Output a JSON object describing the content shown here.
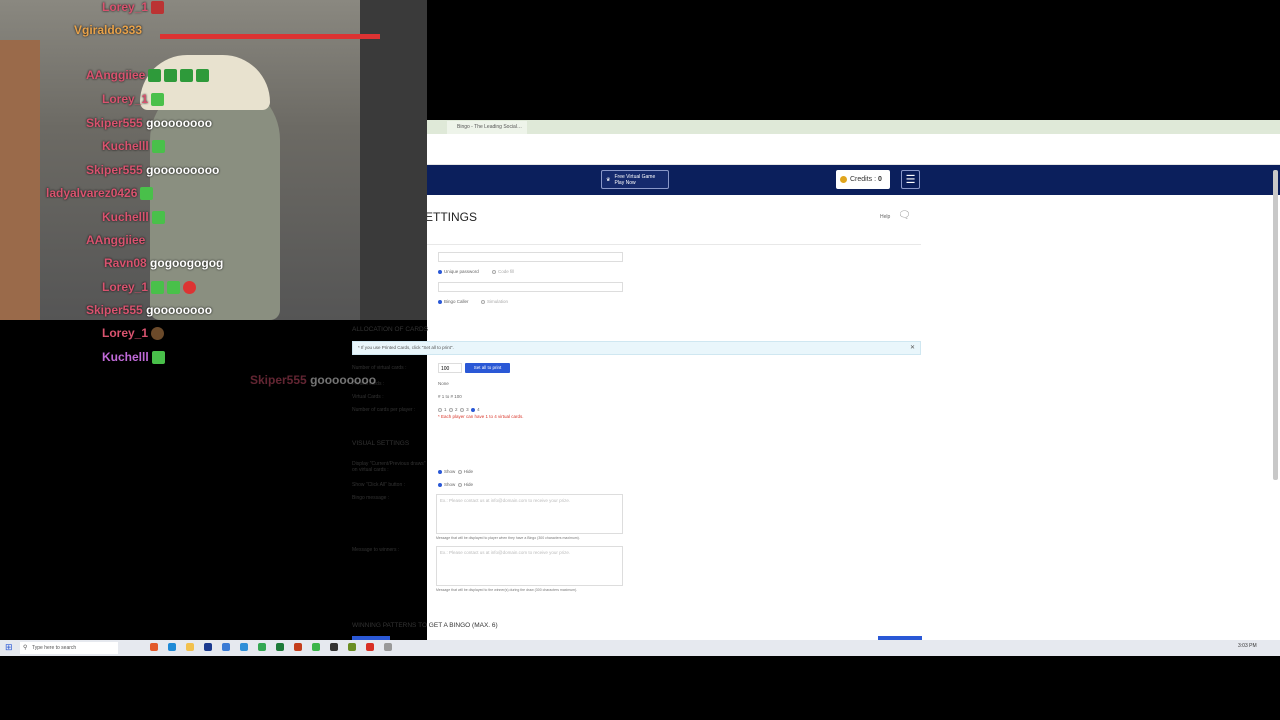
{
  "browser": {
    "tab_title": "Bingo - The Leading Social…",
    "nav": {
      "promo_label": "Free Virtual Game",
      "promo_sub": "Play Now",
      "credits_label": "Credits :",
      "credits_value": "0"
    },
    "page": {
      "title": "ETTINGS",
      "help_label": "Help",
      "unique_password_label": "Unique password",
      "code_label": "Code fill",
      "bingo_caller_label": "Bingo Caller",
      "simulation_label": "Simulation",
      "allocation": {
        "heading": "ALLOCATION OF CARDS",
        "notice": "* If you use Printed Cards, click \"Set all to print\".",
        "virtual_cards_number_label": "Number of virtual cards :",
        "virtual_cards_number_value": "100",
        "set_print_button": "Set all to print",
        "printed_cards_label": "Printed cards :",
        "printed_cards_value": "None",
        "virtual_cards_label": "Virtual Cards :",
        "virtual_cards_value": "# 1 to # 100",
        "cards_per_player_label": "Number of cards per player :",
        "cards_per_player_options": [
          "1",
          "2",
          "3",
          "4"
        ],
        "cards_per_player_note": "* Each player can have 1 to 4 virtual cards."
      },
      "visual": {
        "heading": "VISUAL SETTINGS",
        "display_draws_label": "Display \"Current/Previous draws\" on virtual cards :",
        "show_label": "Show",
        "hide_label": "Hide",
        "click_all_label": "Show \"Click All\" button :",
        "bingo_message_label": "Bingo message :",
        "bingo_message_placeholder": "Ex.: Please contact us at info@domain.com to receive your prize.",
        "bingo_message_help": "Message that will be displayed to player when they have a Bingo (300 characters maximum).",
        "winners_message_label": "Message to winners :",
        "winners_message_placeholder": "Ex.: Please contact us at info@domain.com to receive your prize.",
        "winners_message_help": "Message that will be displayed to the winner(s) during the draw (300 characters maximum)."
      },
      "patterns_heading": "WINNING PATTERNS TO GET A BINGO (MAX. 6)"
    }
  },
  "taskbar": {
    "search_placeholder": "Type here to search",
    "clock": "3:03 PM"
  },
  "stream_chat": [
    {
      "name": "Lorey_1",
      "msg": ""
    },
    {
      "name": "Vgiraldo333",
      "msg": ""
    },
    {
      "name": "AAnggiiee",
      "msg": ""
    },
    {
      "name": "Lorey_1",
      "msg": ""
    },
    {
      "name": "Skiper555",
      "msg": "goooooooo"
    },
    {
      "name": "Kuchelll",
      "msg": ""
    },
    {
      "name": "Skiper555",
      "msg": "gooooooooo"
    },
    {
      "name": "ladyalvarez0426",
      "msg": ""
    },
    {
      "name": "Kuchelll",
      "msg": ""
    },
    {
      "name": "AAnggiiee",
      "msg": ""
    },
    {
      "name": "Ravn08",
      "msg": "gogoogogog"
    },
    {
      "name": "Lorey_1",
      "msg": ""
    },
    {
      "name": "Skiper555",
      "msg": "goooooooo"
    },
    {
      "name": "Lorey_1",
      "msg": ""
    },
    {
      "name": "Kuchelll",
      "msg": ""
    }
  ],
  "chat_fade": {
    "name": "Skiper555",
    "msg": "goooooooo"
  },
  "colors": {
    "navy": "#0b1f5c",
    "accent": "#2a58d6",
    "chat_name": "#d9536f"
  }
}
